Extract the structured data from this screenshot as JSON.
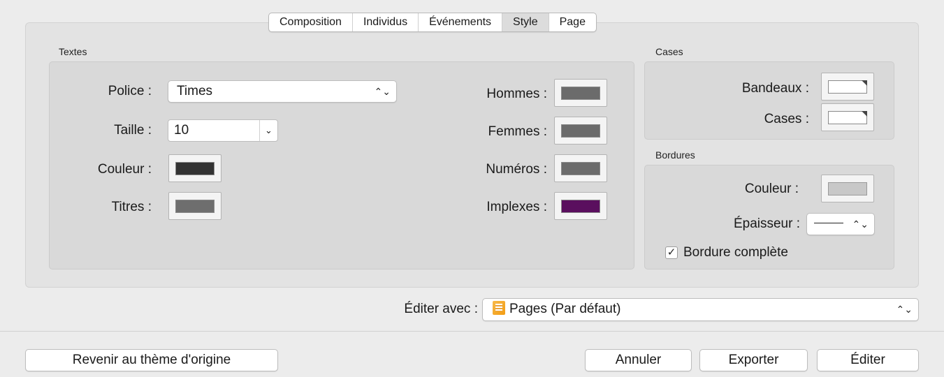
{
  "tabs": [
    "Composition",
    "Individus",
    "Événements",
    "Style",
    "Page"
  ],
  "active_tab": "Style",
  "textes": {
    "group_label": "Textes",
    "police_label": "Police :",
    "police_value": "Times",
    "taille_label": "Taille :",
    "taille_value": "10",
    "couleur_label": "Couleur :",
    "titres_label": "Titres :",
    "hommes_label": "Hommes :",
    "femmes_label": "Femmes :",
    "numeros_label": "Numéros :",
    "implexes_label": "Implexes :"
  },
  "cases": {
    "group_label": "Cases",
    "bandeaux_label": "Bandeaux :",
    "cases_label": "Cases :"
  },
  "bordures": {
    "group_label": "Bordures",
    "couleur_label": "Couleur :",
    "epaisseur_label": "Épaisseur :",
    "bordure_complete_label": "Bordure complète",
    "bordure_complete_checked": true
  },
  "editer_avec": {
    "label": "Éditer avec :",
    "value": "Pages (Par défaut)"
  },
  "buttons": {
    "revenir": "Revenir au thème d'origine",
    "annuler": "Annuler",
    "exporter": "Exporter",
    "editer": "Éditer"
  },
  "colors": {
    "couleur": "#333333",
    "titres": "#6e6e6e",
    "hommes": "#6b6b6b",
    "femmes": "#6b6b6b",
    "numeros": "#6b6b6b",
    "implexes": "#5a0f5e",
    "bandeaux": "#ffffff",
    "cases": "#ffffff",
    "bordure": "#c8c8c8"
  }
}
